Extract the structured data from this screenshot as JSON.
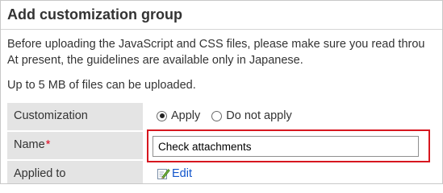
{
  "page": {
    "title": "Add customization group",
    "description_line1": "Before uploading the JavaScript and CSS files, please make sure you read throu",
    "description_line2": "At present, the guidelines are available only in Japanese.",
    "upload_limit": "Up to 5 MB of files can be uploaded."
  },
  "form": {
    "customization": {
      "label": "Customization",
      "options": [
        {
          "label": "Apply",
          "selected": true
        },
        {
          "label": "Do not apply",
          "selected": false
        }
      ]
    },
    "name": {
      "label": "Name",
      "required_mark": "*",
      "value": "Check attachments"
    },
    "applied_to": {
      "label": "Applied to",
      "edit_label": "Edit"
    }
  },
  "colors": {
    "highlight_border": "#d7171f",
    "label_background": "#e4e4e4",
    "link": "#1155cc",
    "required": "#e2001a"
  },
  "icons": {
    "edit": "pencil-edit-icon"
  }
}
